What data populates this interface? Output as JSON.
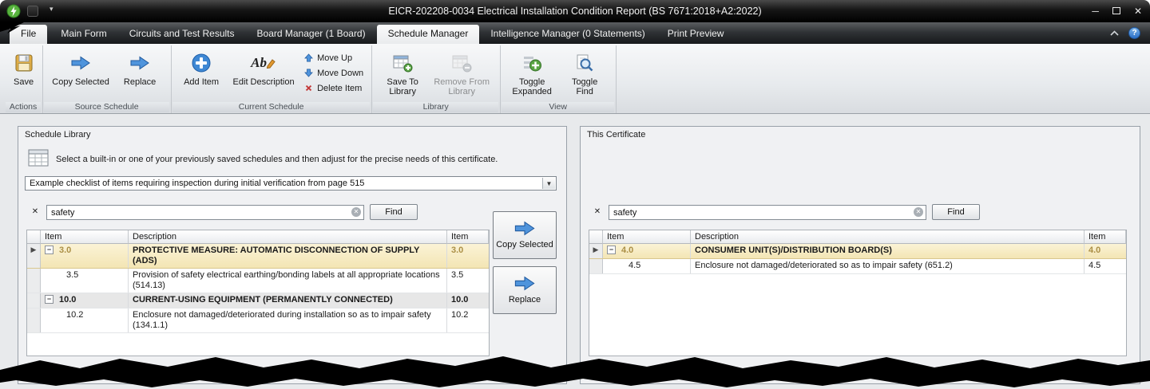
{
  "window": {
    "title": "EICR-202208-0034 Electrical Installation Condition Report (BS 7671:2018+A2:2022)"
  },
  "tabs": [
    {
      "label": "File"
    },
    {
      "label": "Main Form"
    },
    {
      "label": "Circuits and Test Results"
    },
    {
      "label": "Board Manager (1 Board)"
    },
    {
      "label": "Schedule Manager"
    },
    {
      "label": "Intelligence Manager (0 Statements)"
    },
    {
      "label": "Print Preview"
    }
  ],
  "ribbon": {
    "actions": {
      "label": "Actions",
      "save": "Save"
    },
    "source_schedule": {
      "label": "Source Schedule",
      "copy_selected": "Copy Selected",
      "replace": "Replace"
    },
    "current_schedule": {
      "label": "Current Schedule",
      "add_item": "Add Item",
      "edit_description": "Edit Description",
      "move_up": "Move Up",
      "move_down": "Move Down",
      "delete_item": "Delete Item"
    },
    "library": {
      "label": "Library",
      "save_to_library": "Save To Library",
      "remove_from_library": "Remove From Library"
    },
    "view": {
      "label": "View",
      "toggle_expanded": "Toggle Expanded",
      "toggle_find": "Toggle Find"
    }
  },
  "schedule_library": {
    "title": "Schedule Library",
    "intro": "Select a built-in or one of your previously saved schedules and then adjust for the precise needs of this certificate.",
    "schedule_name": "Example checklist of items requiring inspection during initial verification from page 515",
    "search_value": "safety",
    "find_label": "Find",
    "copy_selected_label": "Copy Selected",
    "replace_label": "Replace",
    "columns": {
      "item": "Item",
      "description": "Description",
      "item2": "Item"
    },
    "rows": [
      {
        "item": "3.0",
        "description": "PROTECTIVE MEASURE: AUTOMATIC DISCONNECTION OF SUPPLY (ADS)",
        "item2": "3.0"
      },
      {
        "item": "3.5",
        "description": "Provision of safety electrical earthing/bonding labels at all appropriate locations (514.13)",
        "item2": "3.5"
      },
      {
        "item": "10.0",
        "description": "CURRENT-USING EQUIPMENT (PERMANENTLY CONNECTED)",
        "item2": "10.0"
      },
      {
        "item": "10.2",
        "description": "Enclosure not damaged/deteriorated during installation so as to impair safety (134.1.1)",
        "item2": "10.2"
      }
    ]
  },
  "this_certificate": {
    "title": "This Certificate",
    "search_value": "safety",
    "find_label": "Find",
    "columns": {
      "item": "Item",
      "description": "Description",
      "item2": "Item"
    },
    "rows": [
      {
        "item": "4.0",
        "description": "CONSUMER UNIT(S)/DISTRIBUTION BOARD(S)",
        "item2": "4.0"
      },
      {
        "item": "4.5",
        "description": "Enclosure not damaged/deteriorated so as to impair safety (651.2)",
        "item2": "4.5"
      }
    ]
  },
  "icons": {
    "minimize": "─",
    "close": "✕",
    "dropdown_chevron": "▾",
    "help": "?",
    "collapse": "−",
    "row_pointer": "▶",
    "clear_search": "✕",
    "close_search": "✕",
    "dd_arrow": "▼"
  }
}
